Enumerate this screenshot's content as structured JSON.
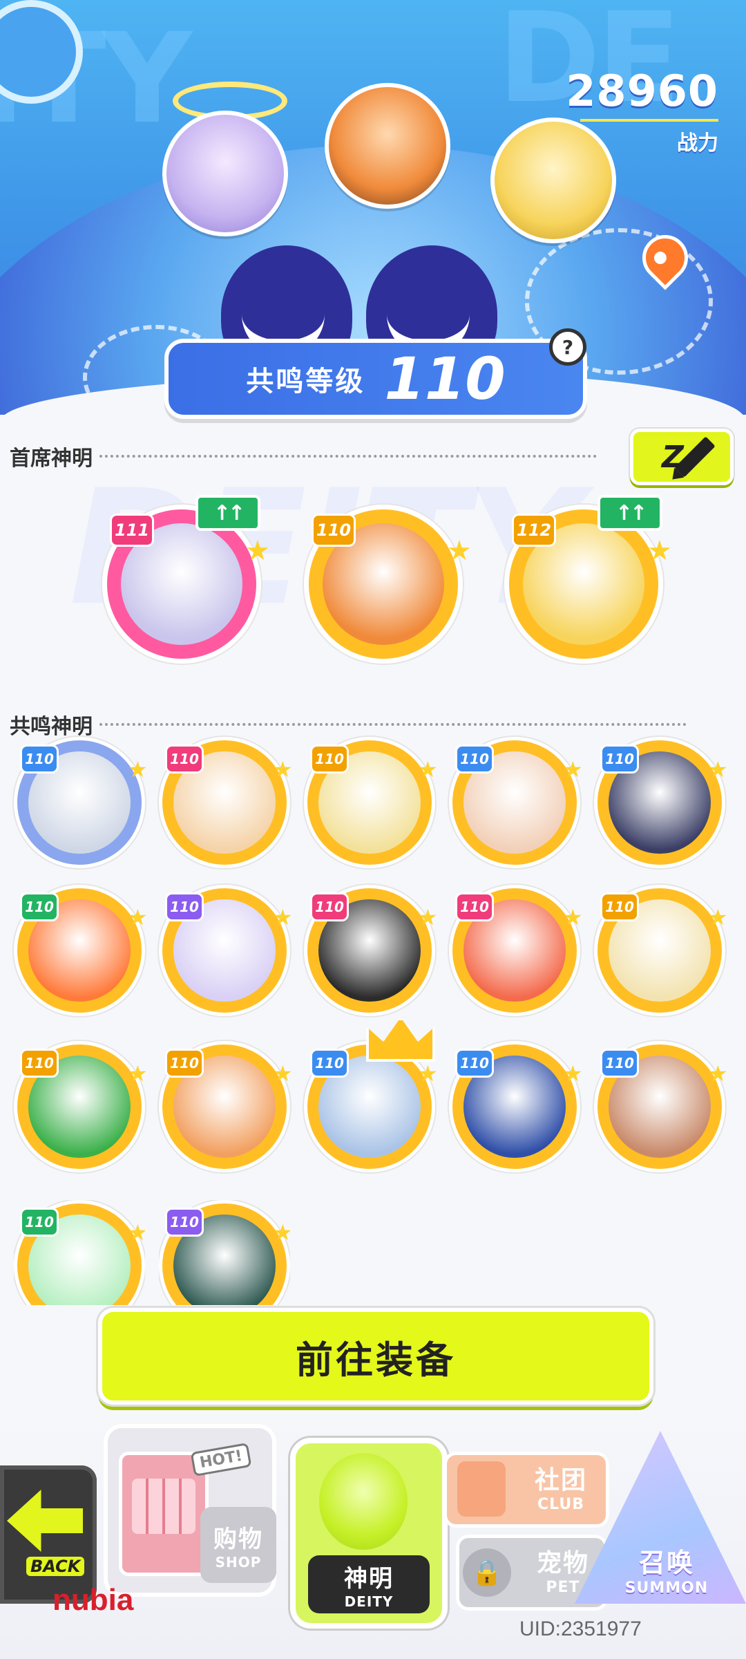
{
  "header": {
    "power_value": "28960",
    "power_label": "战力",
    "resonance_label": "共鸣等级",
    "resonance_value": "110",
    "help_symbol": "?"
  },
  "chief": {
    "title": "首席神明",
    "edit_icon": "pencil-icon",
    "deities": [
      {
        "level": "111",
        "badge_color": "#f03c7a",
        "ring_color": "#ff5aa0",
        "up": true,
        "face": "#c9c5ec"
      },
      {
        "level": "110",
        "badge_color": "#f2a100",
        "ring_color": "#ffbf24",
        "up": false,
        "face": "#f08a3a"
      },
      {
        "level": "112",
        "badge_color": "#f2a100",
        "ring_color": "#ffbf24",
        "up": true,
        "face": "#f7d45c"
      }
    ],
    "up_symbol": "↑↑"
  },
  "resonance": {
    "title": "共鸣神明",
    "deities": [
      {
        "level": "110",
        "badge_color": "#3b8cf0",
        "ring_color": "#8aa6ee",
        "face": "#cfd7e6"
      },
      {
        "level": "110",
        "badge_color": "#f03c7a",
        "ring_color": "#ffbf24",
        "face": "#f5d3a8"
      },
      {
        "level": "110",
        "badge_color": "#f2a100",
        "ring_color": "#ffbf24",
        "face": "#f3e19a"
      },
      {
        "level": "110",
        "badge_color": "#3b8cf0",
        "ring_color": "#ffbf24",
        "face": "#f2d0b8"
      },
      {
        "level": "110",
        "badge_color": "#3b8cf0",
        "ring_color": "#ffbf24",
        "face": "#3b3f66"
      },
      {
        "level": "110",
        "badge_color": "#23b463",
        "ring_color": "#ffbf24",
        "face": "#ff7a3a"
      },
      {
        "level": "110",
        "badge_color": "#8b5cf0",
        "ring_color": "#ffbf24",
        "face": "#d9d0f5"
      },
      {
        "level": "110",
        "badge_color": "#f03c7a",
        "ring_color": "#ffbf24",
        "face": "#2b2b2b"
      },
      {
        "level": "110",
        "badge_color": "#f03c7a",
        "ring_color": "#ffbf24",
        "face": "#f46a4c"
      },
      {
        "level": "110",
        "badge_color": "#f2a100",
        "ring_color": "#ffbf24",
        "face": "#f3e3b0"
      },
      {
        "level": "110",
        "badge_color": "#f2a100",
        "ring_color": "#ffbf24",
        "face": "#3bb04a"
      },
      {
        "level": "110",
        "badge_color": "#f2a100",
        "ring_color": "#ffbf24",
        "face": "#f2a060"
      },
      {
        "level": "110",
        "badge_color": "#3b8cf0",
        "ring_color": "#ffbf24",
        "face": "#a9c3e6"
      },
      {
        "level": "110",
        "badge_color": "#3b8cf0",
        "ring_color": "#ffbf24",
        "face": "#2f4fa8"
      },
      {
        "level": "110",
        "badge_color": "#3b8cf0",
        "ring_color": "#ffbf24",
        "face": "#c98a6a"
      },
      {
        "level": "110",
        "badge_color": "#23b463",
        "ring_color": "#ffbf24",
        "face": "#b5efc0"
      },
      {
        "level": "110",
        "badge_color": "#8b5cf0",
        "ring_color": "#ffbf24",
        "face": "#2f5a52"
      }
    ]
  },
  "actions": {
    "go_equip": "前往装备"
  },
  "nav": {
    "back": "BACK",
    "shop_hot": "HOT!",
    "shop_cn": "购物",
    "shop_en": "SHOP",
    "deity_cn": "神明",
    "deity_en": "DEITY",
    "club_cn": "社团",
    "club_en": "CLUB",
    "pet_cn": "宠物",
    "pet_en": "PET",
    "summon_cn": "召唤",
    "summon_en": "SUMMON"
  },
  "footer": {
    "brand": "nubia",
    "uid": "UID:2351977"
  },
  "colors": {
    "accent_lime": "#e2f51c",
    "hero_blue": "#3f95e8",
    "gold_ring": "#ffbf24"
  }
}
